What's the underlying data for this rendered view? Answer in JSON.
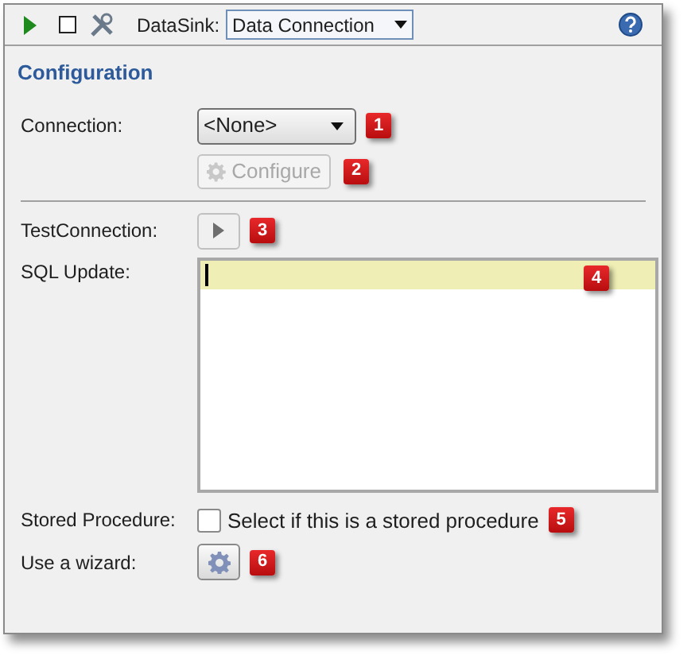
{
  "toolbar": {
    "datasink_label": "DataSink:",
    "datasink_value": "Data Connection"
  },
  "section_title": "Configuration",
  "connection": {
    "label": "Connection:",
    "value": "<None>",
    "badge": "1"
  },
  "configure_button": {
    "label": "Configure",
    "disabled": true,
    "badge": "2"
  },
  "test_connection": {
    "label": "TestConnection:",
    "badge": "3"
  },
  "sql_update": {
    "label": "SQL Update:",
    "badge": "4"
  },
  "stored_procedure": {
    "label": "Stored Procedure:",
    "checkbox_label": "Select if this is a stored procedure",
    "checked": false,
    "badge": "5"
  },
  "wizard": {
    "label": "Use a wizard:",
    "badge": "6"
  }
}
